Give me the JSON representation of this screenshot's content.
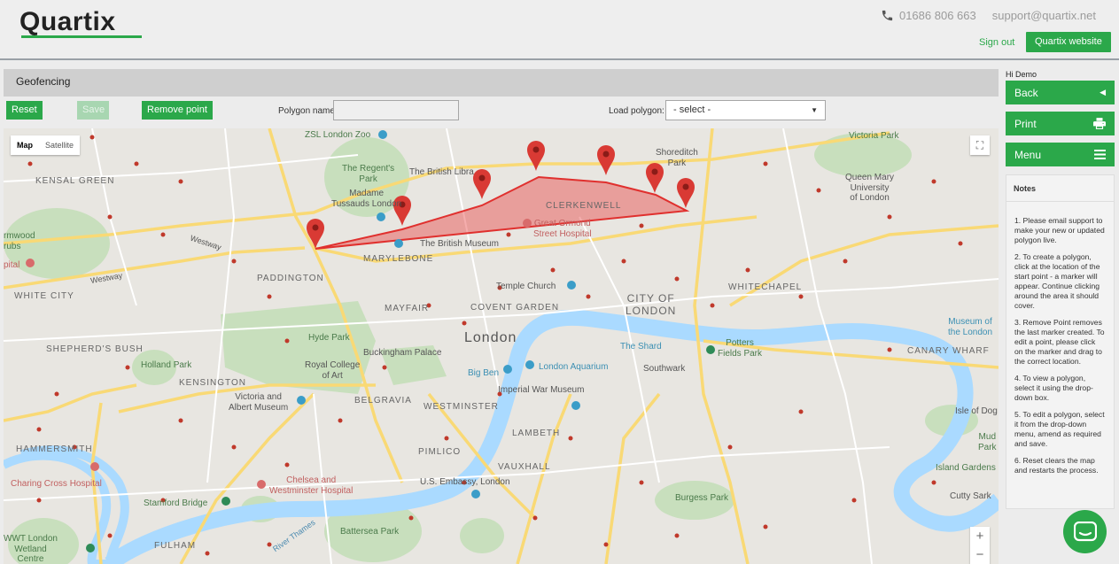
{
  "brand": {
    "name": "Quartix",
    "accent": "#2ba84a"
  },
  "header": {
    "phone": "01686 806 663",
    "email": "support@quartix.net",
    "sign_out": "Sign out",
    "website": "Quartix website"
  },
  "panel": {
    "title": "Geofencing"
  },
  "toolbar": {
    "reset": "Reset",
    "save": "Save",
    "remove_point": "Remove point",
    "polygon_name_label": "Polygon name:",
    "polygon_name_value": "",
    "load_polygon_label": "Load polygon:",
    "load_polygon_selected": "- select -"
  },
  "map": {
    "type_map": "Map",
    "type_satellite": "Satellite",
    "zoom_in": "+",
    "zoom_out": "−",
    "labels": {
      "london": "London",
      "kensal_green": "KENSAL GREEN",
      "white_city": "WHITE CITY",
      "shepherds_bush": "SHEPHERD'S BUSH",
      "hammersmith": "HAMMERSMITH",
      "fulham": "FULHAM",
      "kensington": "KENSINGTON",
      "paddington": "PADDINGTON",
      "marylebone": "MARYLEBONE",
      "mayfair": "MAYFAIR",
      "belgravia": "BELGRAVIA",
      "westminster": "WESTMINSTER",
      "pimlico": "PIMLICO",
      "lambeth": "LAMBETH",
      "vauxhall": "VAUXHALL",
      "covent_garden": "COVENT GARDEN",
      "clerkenwell": "CLERKENWELL",
      "city_of_london": "CITY OF\nLONDON",
      "whitechapel": "WHITECHAPEL",
      "canary_wharf": "CANARY WHARF",
      "zsl": "ZSL London Zoo",
      "regents_park": "The Regent's\nPark",
      "madame_tussauds": "Madame\nTussauds London",
      "british_library": "The British Libra",
      "british_museum": "The British Museum",
      "great_ormond": "Great Ormond\nStreet Hospital",
      "shoreditch_park": "Shoreditch\nPark",
      "victoria_park": "Victoria Park",
      "queen_mary": "Queen Mary\nUniversity\nof London",
      "temple_church": "Temple Church",
      "hyde_park": "Hyde Park",
      "buckingham": "Buckingham Palace",
      "royal_college": "Royal College\nof Art",
      "holland_park": "Holland Park",
      "va_museum": "Victoria and\nAlbert Museum",
      "big_ben": "Big Ben",
      "london_aquarium": "London Aquarium",
      "imperial_war": "Imperial War Museum",
      "the_shard": "The Shard",
      "potters_fields": "Potters\nFields Park",
      "southwark": "Southwark",
      "museum_of_london": "Museum of\nthe London",
      "isle_of_dogs": "Isle of Dog",
      "mudchute": "Mud\nPark",
      "island_gardens": "Island Gardens",
      "cutty_sark": "Cutty Sark",
      "burgess_park": "Burgess Park",
      "us_embassy": "U.S. Embassy, London",
      "battersea_park": "Battersea Park",
      "chelsea_hospital": "Chelsea and\nWestminster Hospital",
      "charing_cross": "Charing Cross Hospital",
      "stamford_bridge": "Stamford Bridge",
      "wwt": "WWT London\nWetland\nCentre",
      "wormwood": "rmwood\nrubs",
      "hospital_left": "pital",
      "westway_1": "Westway",
      "westway_2": "Westway",
      "river_thames": "River Thames"
    }
  },
  "sidebar": {
    "greeting": "Hi Demo",
    "back": "Back",
    "print": "Print",
    "menu": "Menu",
    "notes_title": "Notes",
    "notes": [
      "1. Please email support to make your new or updated polygon live.",
      "2. To create a polygon, click at the location of the start point - a marker will appear. Continue clicking around the area it should cover.",
      "3. Remove Point removes the last marker created. To edit a point, please click on the marker and drag to the correct location.",
      "4. To view a polygon, select it using the drop-down box.",
      "5. To edit a polygon, select it from the drop-down menu, amend as required and save.",
      "6. Reset clears the map and restarts the process."
    ]
  },
  "icons": {
    "phone": "phone-icon",
    "back": "chevron-left-icon",
    "print": "printer-icon",
    "menu": "hamburger-icon",
    "chat": "chat-icon",
    "marker": "map-marker-icon",
    "fullscreen": "fullscreen-icon"
  }
}
